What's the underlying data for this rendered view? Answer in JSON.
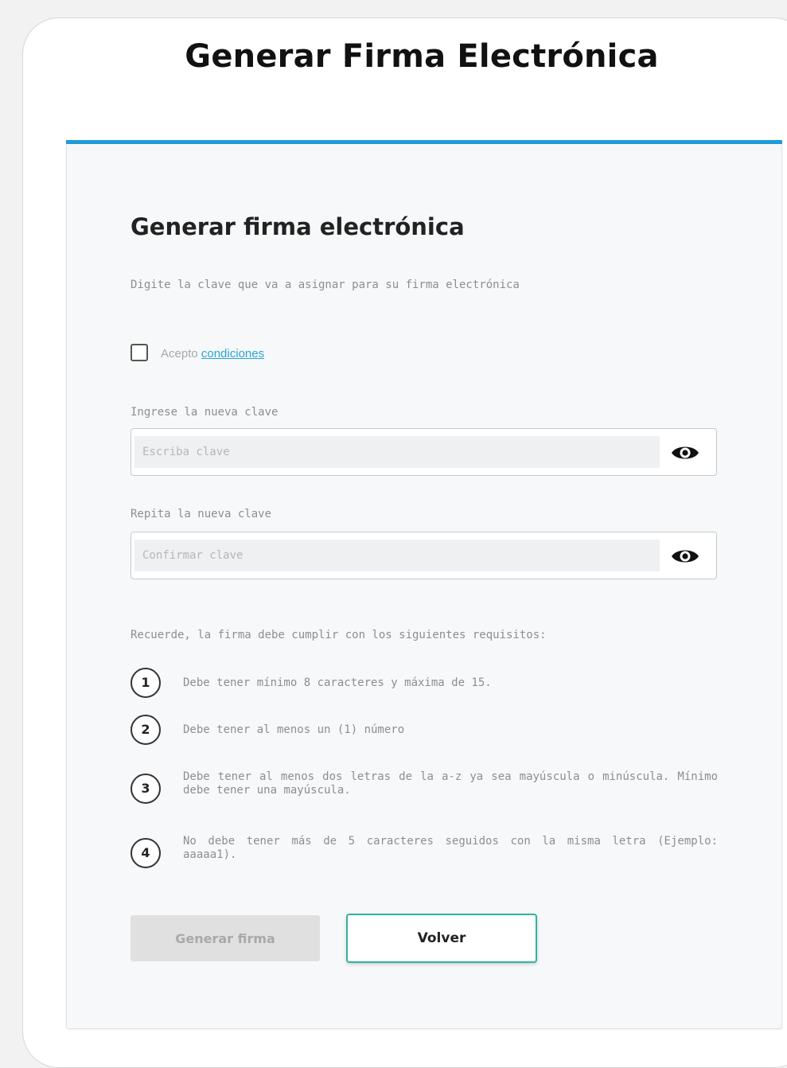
{
  "page": {
    "title": "Generar Firma Electrónica"
  },
  "form": {
    "title": "Generar firma electrónica",
    "instructions": "Digite la clave que va a asignar para su firma electrónica",
    "accept_prefix": "Acepto",
    "accept_link": "condiciones",
    "new_password": {
      "label": "Ingrese la nueva clave",
      "placeholder": "Escriba clave",
      "icon": "eye-icon"
    },
    "confirm_password": {
      "label": "Repita la nueva clave",
      "placeholder": "Confirmar clave",
      "icon": "eye-icon"
    },
    "requirements_intro": "Recuerde, la firma debe cumplir con los siguientes requisitos:",
    "requirements": [
      {
        "num": "1",
        "text": "Debe tener mínimo 8 caracteres y máxima de 15."
      },
      {
        "num": "2",
        "text": "Debe tener al menos un (1) número"
      },
      {
        "num": "3",
        "text": "Debe tener al menos dos letras de la a-z ya sea mayúscula o minúscula. Mínimo debe tener una mayúscula."
      },
      {
        "num": "4",
        "text": "No debe tener más de 5 caracteres seguidos con la misma letra (Ejemplo: aaaaa1)."
      }
    ],
    "generate_button": "Generar firma",
    "back_button": "Volver"
  },
  "colors": {
    "accent_rule": "#1f9bd7",
    "link": "#2aa4d6",
    "back_border": "#2fb39e"
  }
}
